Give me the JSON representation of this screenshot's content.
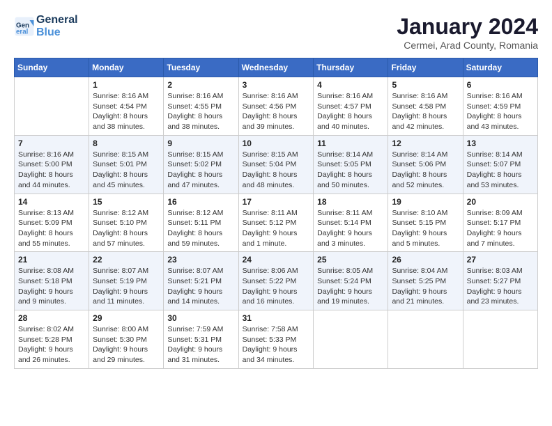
{
  "header": {
    "logo_line1": "General",
    "logo_line2": "Blue",
    "month_title": "January 2024",
    "subtitle": "Cermei, Arad County, Romania"
  },
  "days_of_week": [
    "Sunday",
    "Monday",
    "Tuesday",
    "Wednesday",
    "Thursday",
    "Friday",
    "Saturday"
  ],
  "weeks": [
    [
      {
        "day": "",
        "info": ""
      },
      {
        "day": "1",
        "info": "Sunrise: 8:16 AM\nSunset: 4:54 PM\nDaylight: 8 hours\nand 38 minutes."
      },
      {
        "day": "2",
        "info": "Sunrise: 8:16 AM\nSunset: 4:55 PM\nDaylight: 8 hours\nand 38 minutes."
      },
      {
        "day": "3",
        "info": "Sunrise: 8:16 AM\nSunset: 4:56 PM\nDaylight: 8 hours\nand 39 minutes."
      },
      {
        "day": "4",
        "info": "Sunrise: 8:16 AM\nSunset: 4:57 PM\nDaylight: 8 hours\nand 40 minutes."
      },
      {
        "day": "5",
        "info": "Sunrise: 8:16 AM\nSunset: 4:58 PM\nDaylight: 8 hours\nand 42 minutes."
      },
      {
        "day": "6",
        "info": "Sunrise: 8:16 AM\nSunset: 4:59 PM\nDaylight: 8 hours\nand 43 minutes."
      }
    ],
    [
      {
        "day": "7",
        "info": "Sunrise: 8:16 AM\nSunset: 5:00 PM\nDaylight: 8 hours\nand 44 minutes."
      },
      {
        "day": "8",
        "info": "Sunrise: 8:15 AM\nSunset: 5:01 PM\nDaylight: 8 hours\nand 45 minutes."
      },
      {
        "day": "9",
        "info": "Sunrise: 8:15 AM\nSunset: 5:02 PM\nDaylight: 8 hours\nand 47 minutes."
      },
      {
        "day": "10",
        "info": "Sunrise: 8:15 AM\nSunset: 5:04 PM\nDaylight: 8 hours\nand 48 minutes."
      },
      {
        "day": "11",
        "info": "Sunrise: 8:14 AM\nSunset: 5:05 PM\nDaylight: 8 hours\nand 50 minutes."
      },
      {
        "day": "12",
        "info": "Sunrise: 8:14 AM\nSunset: 5:06 PM\nDaylight: 8 hours\nand 52 minutes."
      },
      {
        "day": "13",
        "info": "Sunrise: 8:14 AM\nSunset: 5:07 PM\nDaylight: 8 hours\nand 53 minutes."
      }
    ],
    [
      {
        "day": "14",
        "info": "Sunrise: 8:13 AM\nSunset: 5:09 PM\nDaylight: 8 hours\nand 55 minutes."
      },
      {
        "day": "15",
        "info": "Sunrise: 8:12 AM\nSunset: 5:10 PM\nDaylight: 8 hours\nand 57 minutes."
      },
      {
        "day": "16",
        "info": "Sunrise: 8:12 AM\nSunset: 5:11 PM\nDaylight: 8 hours\nand 59 minutes."
      },
      {
        "day": "17",
        "info": "Sunrise: 8:11 AM\nSunset: 5:12 PM\nDaylight: 9 hours\nand 1 minute."
      },
      {
        "day": "18",
        "info": "Sunrise: 8:11 AM\nSunset: 5:14 PM\nDaylight: 9 hours\nand 3 minutes."
      },
      {
        "day": "19",
        "info": "Sunrise: 8:10 AM\nSunset: 5:15 PM\nDaylight: 9 hours\nand 5 minutes."
      },
      {
        "day": "20",
        "info": "Sunrise: 8:09 AM\nSunset: 5:17 PM\nDaylight: 9 hours\nand 7 minutes."
      }
    ],
    [
      {
        "day": "21",
        "info": "Sunrise: 8:08 AM\nSunset: 5:18 PM\nDaylight: 9 hours\nand 9 minutes."
      },
      {
        "day": "22",
        "info": "Sunrise: 8:07 AM\nSunset: 5:19 PM\nDaylight: 9 hours\nand 11 minutes."
      },
      {
        "day": "23",
        "info": "Sunrise: 8:07 AM\nSunset: 5:21 PM\nDaylight: 9 hours\nand 14 minutes."
      },
      {
        "day": "24",
        "info": "Sunrise: 8:06 AM\nSunset: 5:22 PM\nDaylight: 9 hours\nand 16 minutes."
      },
      {
        "day": "25",
        "info": "Sunrise: 8:05 AM\nSunset: 5:24 PM\nDaylight: 9 hours\nand 19 minutes."
      },
      {
        "day": "26",
        "info": "Sunrise: 8:04 AM\nSunset: 5:25 PM\nDaylight: 9 hours\nand 21 minutes."
      },
      {
        "day": "27",
        "info": "Sunrise: 8:03 AM\nSunset: 5:27 PM\nDaylight: 9 hours\nand 23 minutes."
      }
    ],
    [
      {
        "day": "28",
        "info": "Sunrise: 8:02 AM\nSunset: 5:28 PM\nDaylight: 9 hours\nand 26 minutes."
      },
      {
        "day": "29",
        "info": "Sunrise: 8:00 AM\nSunset: 5:30 PM\nDaylight: 9 hours\nand 29 minutes."
      },
      {
        "day": "30",
        "info": "Sunrise: 7:59 AM\nSunset: 5:31 PM\nDaylight: 9 hours\nand 31 minutes."
      },
      {
        "day": "31",
        "info": "Sunrise: 7:58 AM\nSunset: 5:33 PM\nDaylight: 9 hours\nand 34 minutes."
      },
      {
        "day": "",
        "info": ""
      },
      {
        "day": "",
        "info": ""
      },
      {
        "day": "",
        "info": ""
      }
    ]
  ]
}
